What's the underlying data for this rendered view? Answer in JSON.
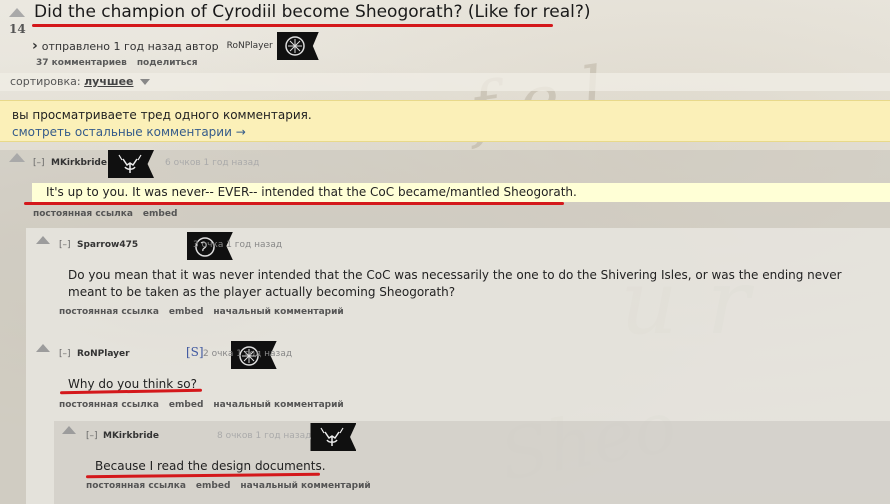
{
  "post": {
    "score": "14",
    "title": "Did the champion of Cyrodiil become Sheogorath? (Like for real?)",
    "submitted": "отправлено 1 год назад автор",
    "author": "RoNPlayer",
    "links": [
      "37 комментариев",
      "поделиться"
    ]
  },
  "sort": {
    "label": "сортировка:",
    "selected": "лучшее"
  },
  "notice": {
    "text": "вы просматриваете тред одного комментария.",
    "link": "смотреть остальные комментарии →"
  },
  "comments": [
    {
      "toggle": "[–]",
      "author": "MKirkbride",
      "meta": "6 очков 1 год назад",
      "body": "It's up to you. It was never-- EVER-- intended that the CoC became/mantled Sheogorath.",
      "links": [
        "постоянная ссылка",
        "embed"
      ]
    },
    {
      "toggle": "[–]",
      "author": "Sparrow475",
      "meta": "3 очка 1 год назад",
      "body_line1": "Do you mean that it was never intended that the CoC was necessarily the one to do the Shivering Isles, or was the ending never",
      "body_line2": "meant to be taken as the player actually becoming Sheogorath?",
      "links": [
        "постоянная ссылка",
        "embed",
        "начальный комментарий"
      ]
    },
    {
      "toggle": "[–]",
      "author": "RoNPlayer",
      "submitter_tag": "[S]",
      "meta": "2 очка 1 год назад",
      "body": "Why do you think so?",
      "links": [
        "постоянная ссылка",
        "embed",
        "начальный комментарий"
      ]
    },
    {
      "toggle": "[–]",
      "author": "MKirkbride",
      "meta": "8 очков 1 год назад",
      "body": "Because I read the design documents.",
      "links": [
        "постоянная ссылка",
        "embed",
        "начальный комментарий"
      ]
    }
  ],
  "colors": {
    "underline": "#d4181b",
    "notice_bg": "#fbf0b8",
    "link": "#355b8a"
  }
}
